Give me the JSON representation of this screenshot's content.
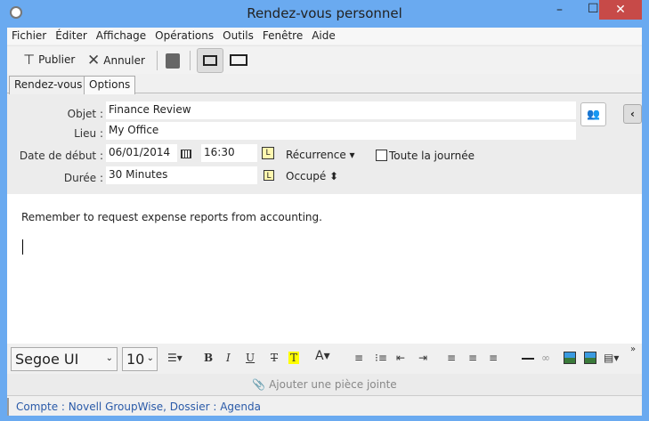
{
  "window": {
    "title": "Rendez-vous personnel",
    "close": "✕",
    "minimize": "–",
    "maximize": "☐"
  },
  "menu": [
    "Fichier",
    "Éditer",
    "Affichage",
    "Opérations",
    "Outils",
    "Fenêtre",
    "Aide"
  ],
  "toolbar": {
    "publish": "Publier",
    "cancel": "Annuler"
  },
  "tabs": [
    "Rendez-vous",
    "Options"
  ],
  "form": {
    "subject_label": "Objet :",
    "subject": "Finance Review",
    "place_label": "Lieu :",
    "place": "My Office",
    "start_label": "Date de début :",
    "date": "06/01/2014",
    "time": "16:30",
    "recurrence": "Récurrence ▾",
    "allday": "Toute la journée",
    "duration_label": "Durée :",
    "duration": "30 Minutes",
    "busy": "Occupé ⬍"
  },
  "body": {
    "text": "Remember to request expense reports from accounting."
  },
  "format": {
    "font": "Segoe UI",
    "size": "10",
    "bold": "B",
    "italic": "I",
    "underline": "U",
    "strike": "T",
    "highlight": "T"
  },
  "attach": "Ajouter une pièce jointe",
  "status": "Compte : Novell GroupWise,  Dossier : Agenda"
}
